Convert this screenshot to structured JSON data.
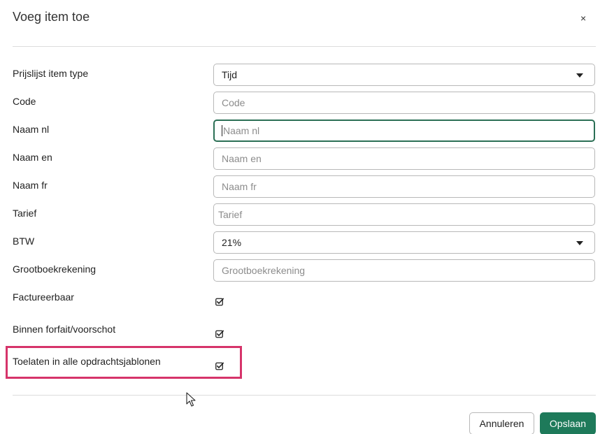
{
  "dialog": {
    "title": "Voeg item toe",
    "close_label": "×"
  },
  "form": {
    "type_label": "Prijslijst item type",
    "type_value": "Tijd",
    "code_label": "Code",
    "code_placeholder": "Code",
    "naam_nl_label": "Naam nl",
    "naam_nl_placeholder": "Naam nl",
    "naam_en_label": "Naam en",
    "naam_en_placeholder": "Naam en",
    "naam_fr_label": "Naam fr",
    "naam_fr_placeholder": "Naam fr",
    "tarief_label": "Tarief",
    "tarief_placeholder": "Tarief",
    "btw_label": "BTW",
    "btw_value": "21%",
    "grootboek_label": "Grootboekrekening",
    "grootboek_placeholder": "Grootboekrekening",
    "factureerbaar_label": "Factureerbaar",
    "factureerbaar_checked": true,
    "forfait_label": "Binnen forfait/voorschot",
    "forfait_checked": true,
    "toelaten_label": "Toelaten in alle opdrachtsjablonen",
    "toelaten_checked": true
  },
  "footer": {
    "cancel_label": "Annuleren",
    "save_label": "Opslaan"
  },
  "colors": {
    "accent": "#1e7a5a",
    "focus_border": "#2b6f55",
    "highlight": "#d6346a"
  }
}
